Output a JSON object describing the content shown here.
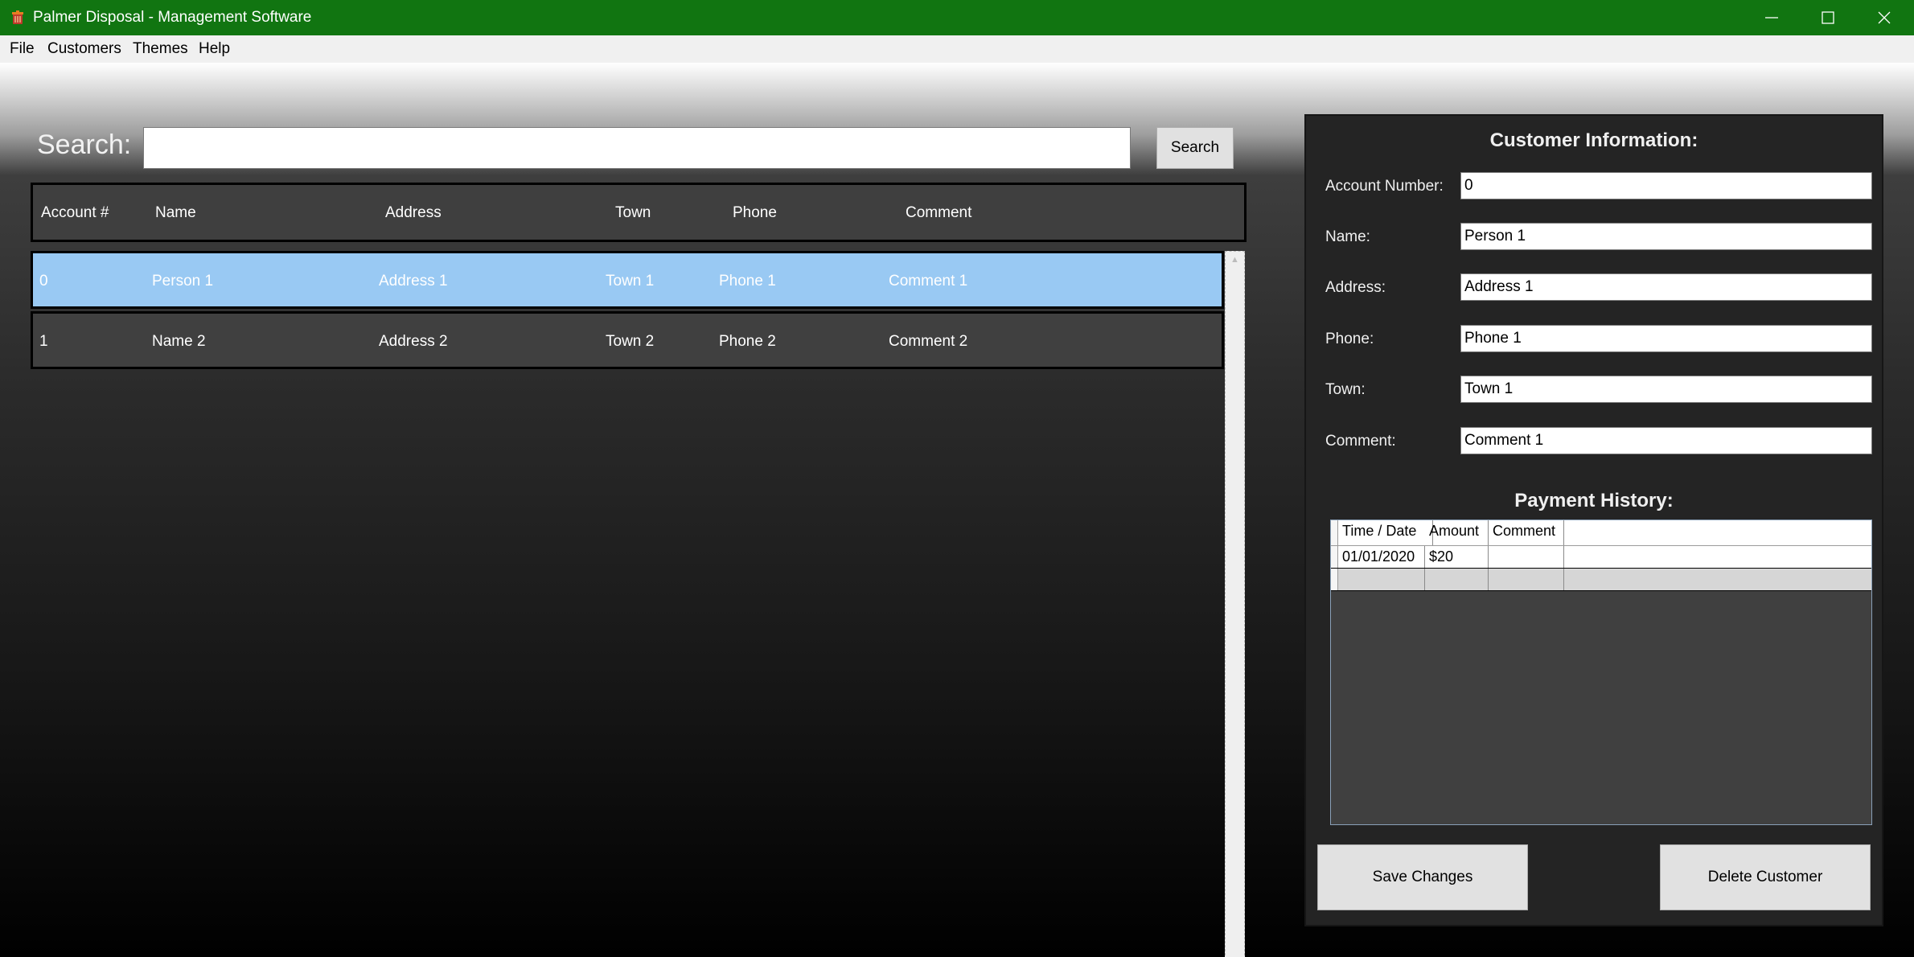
{
  "window": {
    "title": "Palmer Disposal - Management Software",
    "icon": "recycle-bin-app-icon",
    "accent_color": "#117511"
  },
  "menu": {
    "items": [
      {
        "label": "File"
      },
      {
        "label": "Customers"
      },
      {
        "label": "Themes"
      },
      {
        "label": "Help"
      }
    ]
  },
  "search": {
    "label": "Search:",
    "value": "",
    "button_label": "Search"
  },
  "customer_grid": {
    "columns": [
      "Account #",
      "Name",
      "Address",
      "Town",
      "Phone",
      "Comment"
    ],
    "rows": [
      {
        "account": "0",
        "name": "Person 1",
        "address": "Address 1",
        "town": "Town 1",
        "phone": "Phone 1",
        "comment": "Comment 1",
        "selected": true
      },
      {
        "account": "1",
        "name": "Name 2",
        "address": "Address 2",
        "town": "Town 2",
        "phone": "Phone 2",
        "comment": "Comment 2",
        "selected": false
      }
    ],
    "selected_color": "#99c9f3"
  },
  "customer_info": {
    "title": "Customer Information:",
    "fields": [
      {
        "label": "Account Number:",
        "value": "0"
      },
      {
        "label": "Name:",
        "value": "Person 1"
      },
      {
        "label": "Address:",
        "value": "Address 1"
      },
      {
        "label": "Phone:",
        "value": "Phone 1"
      },
      {
        "label": "Town:",
        "value": "Town 1"
      },
      {
        "label": "Comment:",
        "value": "Comment 1"
      }
    ]
  },
  "payment_history": {
    "title": "Payment History:",
    "columns": [
      "Time / Date",
      "Amount",
      "Comment"
    ],
    "rows": [
      {
        "date": "01/01/2020",
        "amount": "$20",
        "comment": ""
      }
    ]
  },
  "actions": {
    "save_label": "Save Changes",
    "delete_label": "Delete Customer"
  }
}
